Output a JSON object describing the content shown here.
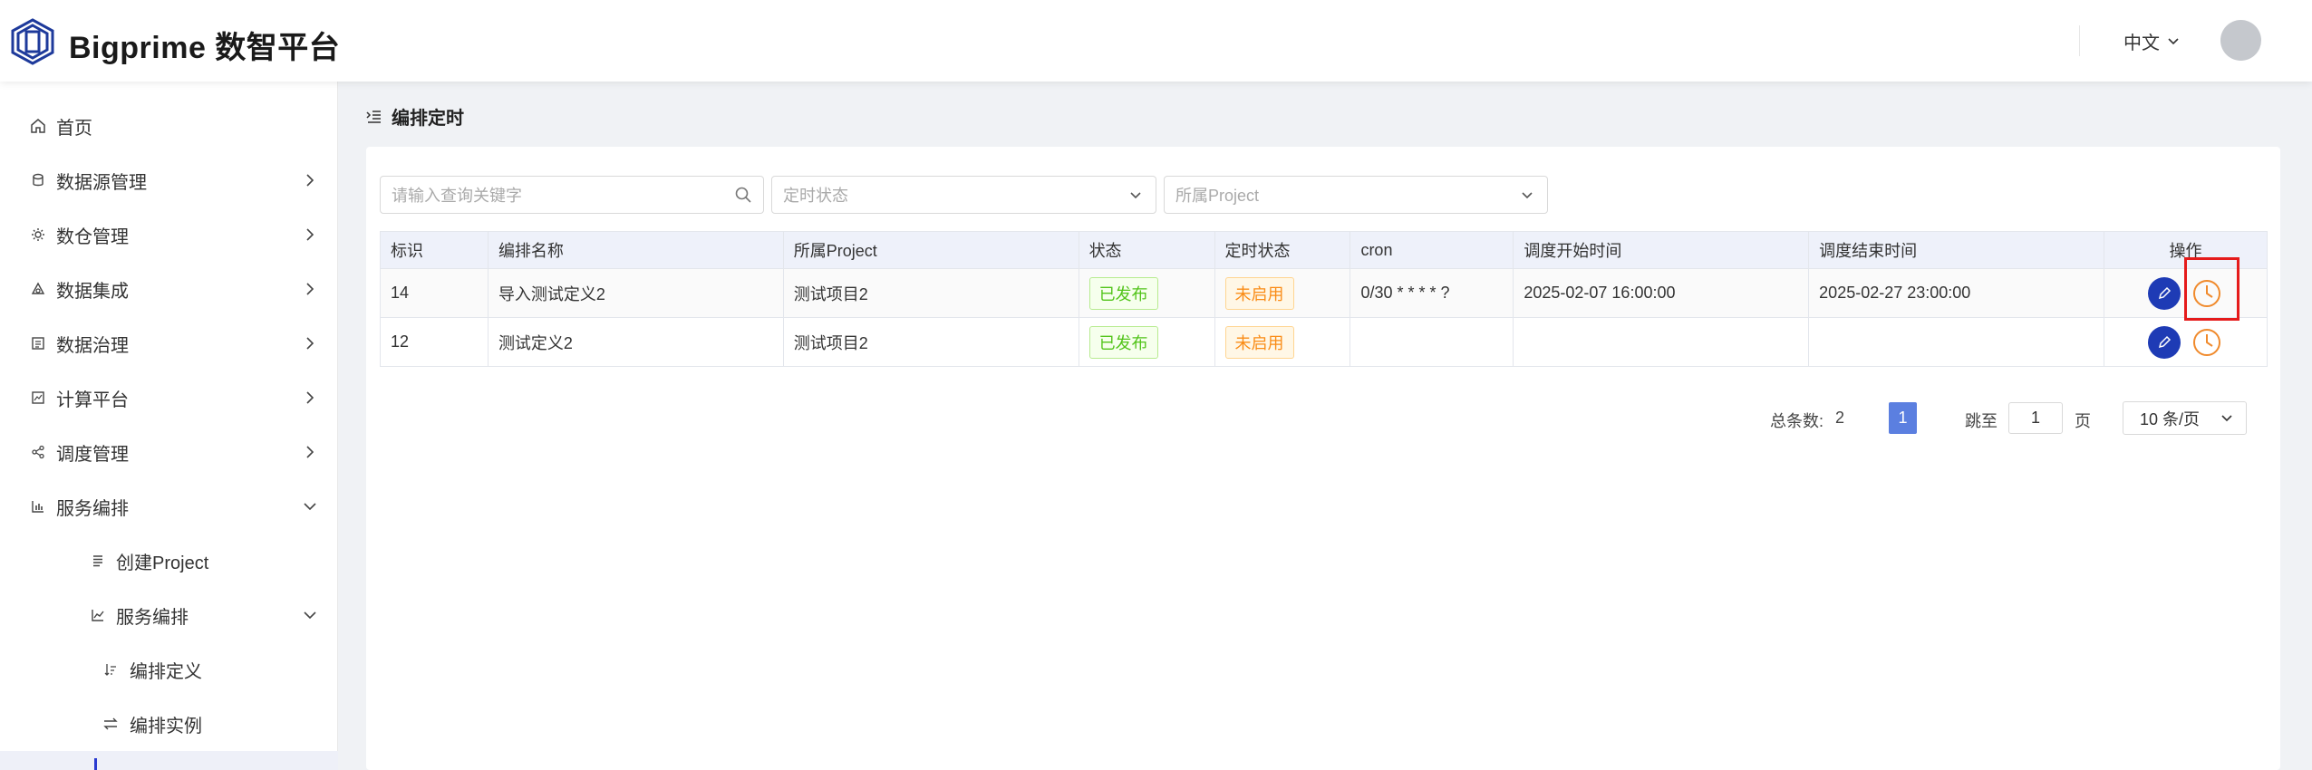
{
  "header": {
    "brand": "Bigprime 数智平台",
    "language": "中文"
  },
  "sidebar": {
    "items": [
      {
        "label": "首页",
        "icon": "home-icon"
      },
      {
        "label": "数据源管理",
        "icon": "database-icon"
      },
      {
        "label": "数仓管理",
        "icon": "warehouse-icon"
      },
      {
        "label": "数据集成",
        "icon": "integration-icon"
      },
      {
        "label": "数据治理",
        "icon": "governance-icon"
      },
      {
        "label": "计算平台",
        "icon": "compute-icon"
      },
      {
        "label": "调度管理",
        "icon": "share-icon"
      },
      {
        "label": "服务编排",
        "icon": "bar-chart-icon"
      },
      {
        "label": "创建Project",
        "icon": "list-icon"
      },
      {
        "label": "服务编排",
        "icon": "line-chart-icon"
      },
      {
        "label": "编排定义",
        "icon": "sort-icon"
      },
      {
        "label": "编排实例",
        "icon": "swap-icon"
      }
    ]
  },
  "page": {
    "title": "编排定时"
  },
  "filters": {
    "search_placeholder": "请输入查询关键字",
    "status_placeholder": "定时状态",
    "project_placeholder": "所属Project"
  },
  "table": {
    "columns": [
      "标识",
      "编排名称",
      "所属Project",
      "状态",
      "定时状态",
      "cron",
      "调度开始时间",
      "调度结束时间",
      "操作"
    ],
    "rows": [
      {
        "id": "14",
        "name": "导入测试定义2",
        "project": "测试项目2",
        "status": "已发布",
        "timer_status": "未启用",
        "cron": "0/30 * * * * ?",
        "start": "2025-02-07 16:00:00",
        "end": "2025-02-27 23:00:00"
      },
      {
        "id": "12",
        "name": "测试定义2",
        "project": "测试项目2",
        "status": "已发布",
        "timer_status": "未启用",
        "cron": "",
        "start": "",
        "end": ""
      }
    ]
  },
  "pagination": {
    "total_label": "总条数:",
    "total": "2",
    "current_page": "1",
    "jump_label": "跳至",
    "jump_value": "1",
    "page_suffix": "页",
    "page_size": "10 条/页"
  },
  "colors": {
    "accent": "#2a3bd0",
    "primary_button": "#1e3bb5",
    "page_active": "#5b7fe0",
    "highlight": "#e51b1b",
    "tag_green": "#52c41a",
    "tag_orange": "#fa8c16"
  }
}
